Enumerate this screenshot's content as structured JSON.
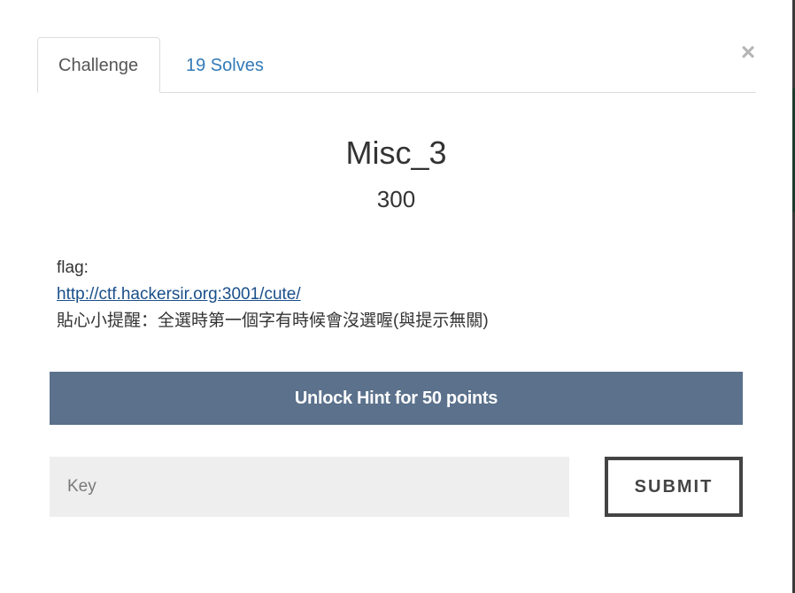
{
  "tabs": {
    "challenge": "Challenge",
    "solves": "19 Solves"
  },
  "close_symbol": "×",
  "challenge": {
    "name": "Misc_3",
    "value": "300",
    "description": {
      "line1": "flag:",
      "link": "http://ctf.hackersir.org:3001/cute/",
      "line3": "貼心小提醒：全選時第一個字有時候會沒選喔(與提示無關)"
    }
  },
  "hint_button": "Unlock Hint for 50 points",
  "key_field": {
    "placeholder": "Key",
    "value": ""
  },
  "submit_button": "SUBMIT",
  "colors": {
    "hint_bg": "#5b718c",
    "link": "#1a4f8a",
    "tab_link": "#337ab7",
    "input_bg": "#eeeeee",
    "submit_border": "#444444"
  },
  "icons": {
    "close": "close-icon"
  }
}
